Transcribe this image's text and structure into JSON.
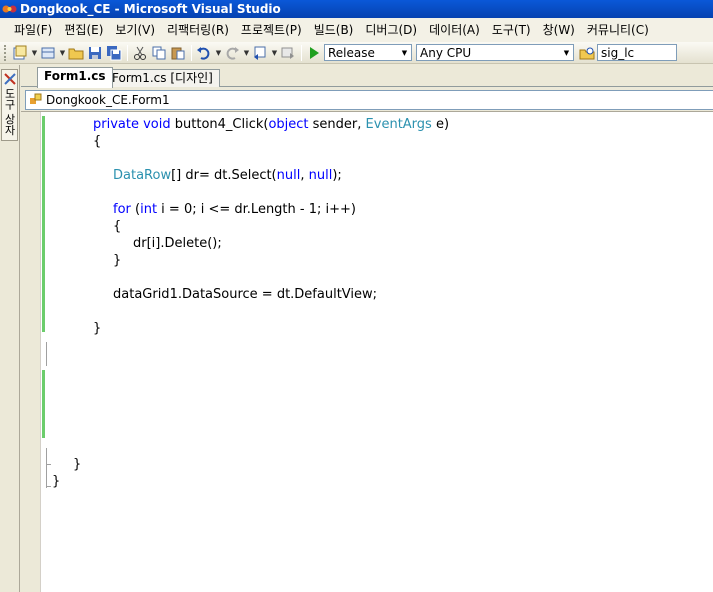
{
  "window": {
    "title": "Dongkook_CE - Microsoft Visual Studio"
  },
  "menu": [
    "파일(F)",
    "편집(E)",
    "보기(V)",
    "리팩터링(R)",
    "프로젝트(P)",
    "빌드(B)",
    "디버그(D)",
    "데이터(A)",
    "도구(T)",
    "창(W)",
    "커뮤니티(C)"
  ],
  "toolbar": {
    "config": "Release",
    "platform": "Any CPU",
    "find": "sig_lc"
  },
  "toolbox": {
    "label": "도구 상자"
  },
  "tabs": [
    {
      "label": "Form1.cs",
      "active": true
    },
    {
      "label": "Form1.cs [디자인]",
      "active": false
    }
  ],
  "nav": {
    "type": "Dongkook_CE.Form1"
  },
  "code": {
    "l1": {
      "kw1": "private",
      "kw2": "void",
      "name": "button4_Click(",
      "kw3": "object",
      "mid": " sender, ",
      "ty": "EventArgs",
      "end": " e)"
    },
    "l2": "{",
    "l3": {
      "ty": "DataRow",
      "mid": "[] dr= dt.Select(",
      "kw1": "null",
      "sep": ", ",
      "kw2": "null",
      "end": ");"
    },
    "l4": {
      "kw1": "for",
      "a": " (",
      "kw2": "int",
      "b": " i = 0; i <= dr.Length - 1; i++)"
    },
    "l5": "{",
    "l6": "dr[i].Delete();",
    "l7": "}",
    "l8": "dataGrid1.DataSource = dt.DefaultView;",
    "l9": "}",
    "l10": "}",
    "l11": "}"
  },
  "colors": {
    "keyword": "#0000ff",
    "type": "#2b91af",
    "change_marker": "#6ccd6c"
  }
}
